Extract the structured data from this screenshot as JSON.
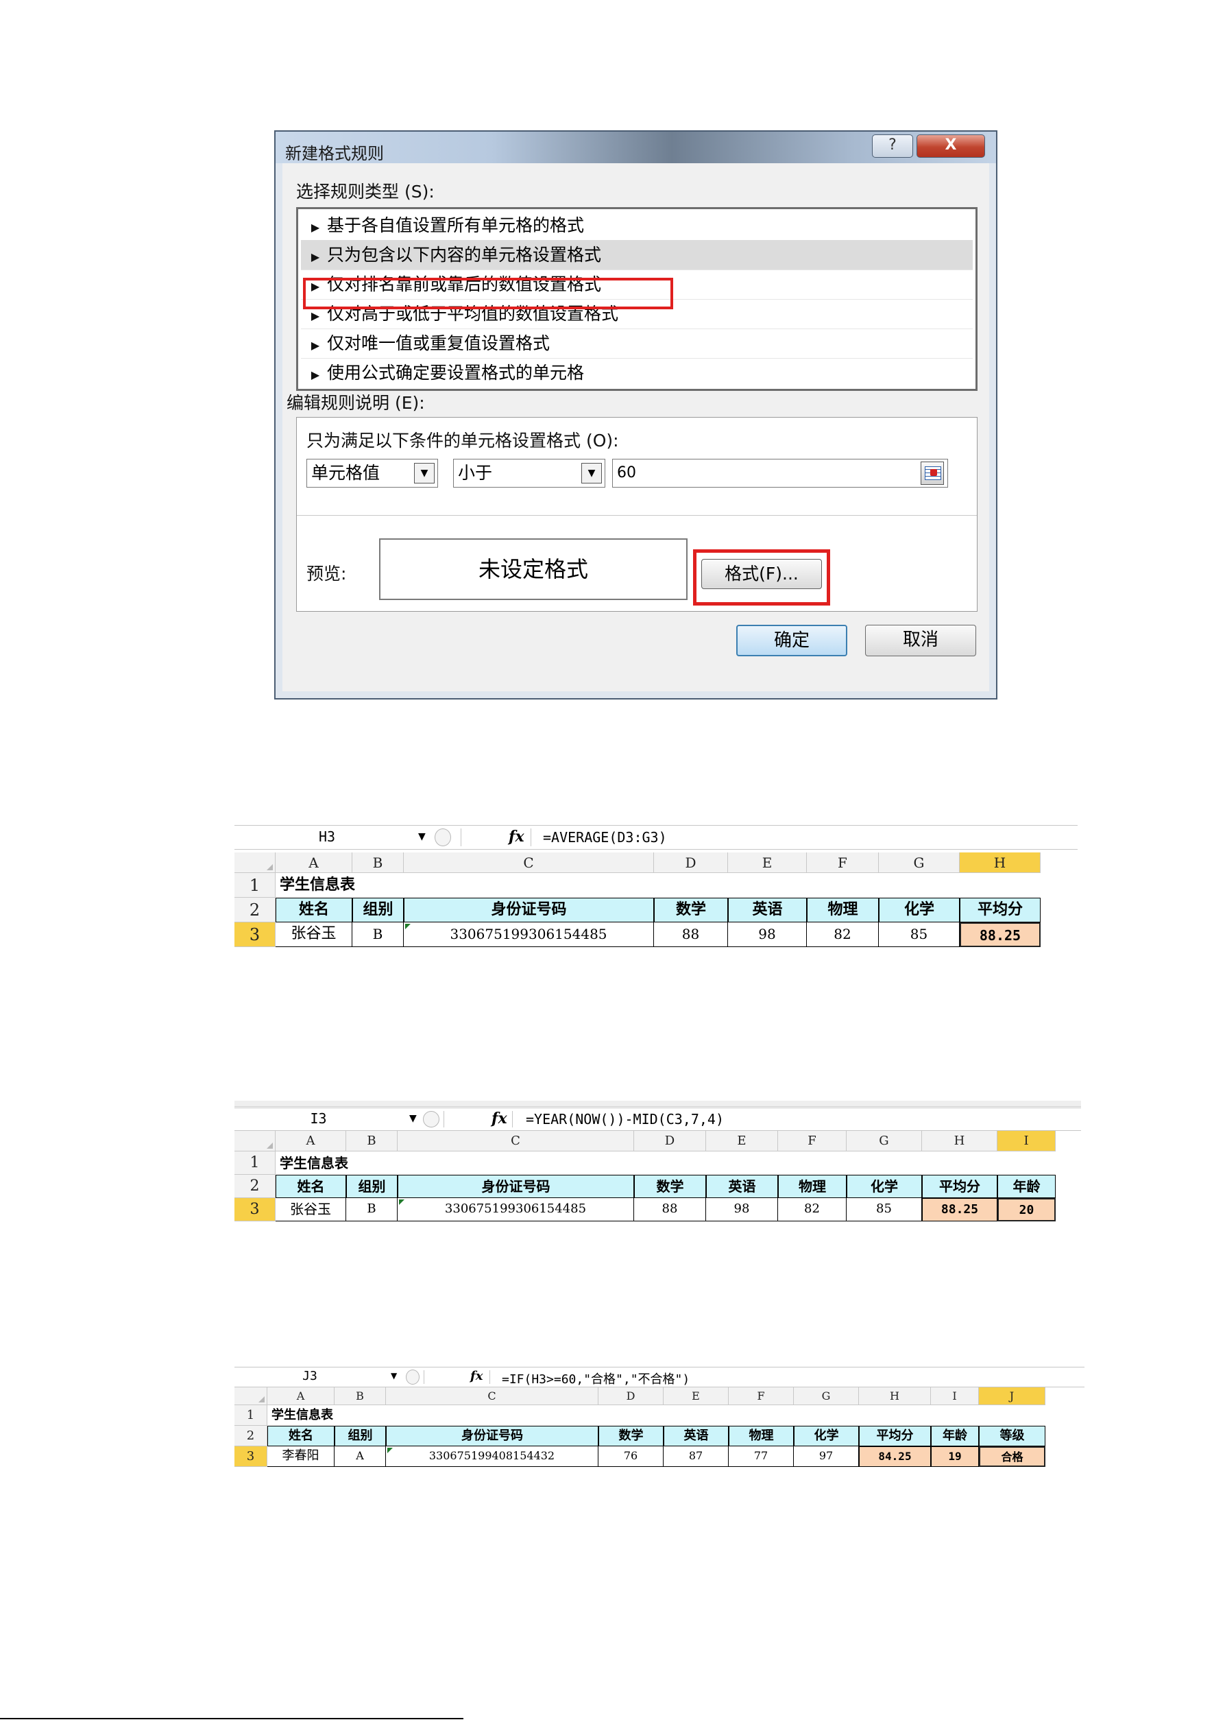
{
  "dialog": {
    "title": "新建格式规则",
    "help_label": "?",
    "close_label": "X",
    "rule_type_label": "选择规则类型 (S):",
    "rule_items": [
      "基于各自值设置所有单元格的格式",
      "只为包含以下内容的单元格设置格式",
      "仅对排名靠前或靠后的数值设置格式",
      "仅对高于或低于平均值的数值设置格式",
      "仅对唯一值或重复值设置格式",
      "使用公式确定要设置格式的单元格"
    ],
    "selected_rule_index": 1,
    "edit_label": "编辑规则说明 (E):",
    "condition_label": "只为满足以下条件的单元格设置格式 (O):",
    "field_select": "单元格值",
    "operator_select": "小于",
    "value": "60",
    "preview_label": "预览:",
    "preview_text": "未设定格式",
    "format_button": "格式(F)...",
    "ok_button": "确定",
    "cancel_button": "取消"
  },
  "sheets": [
    {
      "namebox": "H3",
      "formula": "=AVERAGE(D3:G3)",
      "columns": [
        "A",
        "B",
        "C",
        "D",
        "E",
        "F",
        "G",
        "H"
      ],
      "active_column": "H",
      "rows": [
        "1",
        "2",
        "3"
      ],
      "active_row": "3",
      "title": "学生信息表",
      "headers": [
        "姓名",
        "组别",
        "身份证号码",
        "数学",
        "英语",
        "物理",
        "化学",
        "平均分"
      ],
      "values": [
        "张谷玉",
        "B",
        "330675199306154485",
        "88",
        "98",
        "82",
        "85",
        "88.25"
      ]
    },
    {
      "namebox": "I3",
      "formula": "=YEAR(NOW())-MID(C3,7,4)",
      "columns": [
        "A",
        "B",
        "C",
        "D",
        "E",
        "F",
        "G",
        "H",
        "I"
      ],
      "active_column": "I",
      "rows": [
        "1",
        "2",
        "3"
      ],
      "active_row": "3",
      "title": "学生信息表",
      "headers": [
        "姓名",
        "组别",
        "身份证号码",
        "数学",
        "英语",
        "物理",
        "化学",
        "平均分",
        "年龄"
      ],
      "values": [
        "张谷玉",
        "B",
        "330675199306154485",
        "88",
        "98",
        "82",
        "85",
        "88.25",
        "20"
      ]
    },
    {
      "namebox": "J3",
      "formula": "=IF(H3>=60,\"合格\",\"不合格\")",
      "columns": [
        "A",
        "B",
        "C",
        "D",
        "E",
        "F",
        "G",
        "H",
        "I",
        "J"
      ],
      "active_column": "J",
      "rows": [
        "1",
        "2",
        "3"
      ],
      "active_row": "3",
      "title": "学生信息表",
      "headers": [
        "姓名",
        "组别",
        "身份证号码",
        "数学",
        "英语",
        "物理",
        "化学",
        "平均分",
        "年龄",
        "等级"
      ],
      "values": [
        "李春阳",
        "A",
        "330675199408154432",
        "76",
        "87",
        "77",
        "97",
        "84.25",
        "19",
        "合格"
      ]
    }
  ],
  "colors": {
    "header_cyan": "#ccf4fa",
    "orange_fill": "#fbd4b4",
    "active_header": "#f7cf47",
    "highlight_red": "#e0201f"
  }
}
